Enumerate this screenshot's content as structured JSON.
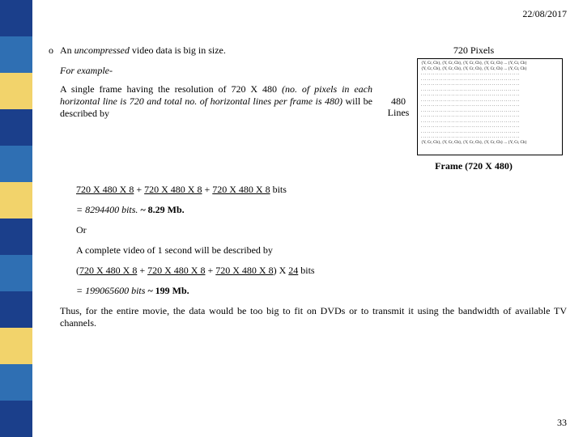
{
  "date": "22/08/2017",
  "bullet": {
    "marker": "o",
    "text_pre": "An ",
    "text_em": "uncompressed",
    "text_post": " video data is big in size."
  },
  "example_label": "For example-",
  "frame_desc_pre": "A single frame having the resolution of 720 X 480 ",
  "frame_desc_em": "(no. of pixels in each horizontal line is 720 and total no. of horizontal lines per frame is 480)",
  "frame_desc_post": " will be described by",
  "figure": {
    "top_label": "720 Pixels",
    "left_label_a": "480",
    "left_label_b": "Lines",
    "pixel_row": "{Y, Cr, Cb}, {Y, Cr, Cb}, {Y, Cr, Cb}, {Y, Cr, Cb} ... {Y, Cr, Cb}",
    "dot_row": ". . . . . . . . . . . . . . . . . . . . . . . . . . . . . . . . . . . . . . . . . . . . . . . . .",
    "caption": "Frame (720 X 480)"
  },
  "calc": {
    "line1_a": "720 X 480 X 8",
    "line1_b": "720 X 480 X 8",
    "line1_c": "720 X 480 X 8",
    "line1_suffix": "  bits",
    "line2_a": "= 8294400  bits.",
    "line2_b": "~ 8.29 Mb.",
    "or": "Or",
    "line3": "A complete video of 1 second will be described by",
    "line4_open": "(",
    "line4_a": "720 X 480 X 8",
    "line4_b": "720 X 480 X 8",
    "line4_c": "720 X 480 X 8",
    "line4_mid": ") X ",
    "line4_d": "24",
    "line4_suffix": " bits",
    "line5_a": "= 199065600 bits",
    "line5_b": "~ 199 Mb."
  },
  "conclusion": "Thus, for the entire movie, the data would be too big to fit on DVDs or to transmit it using the bandwidth of available TV channels.",
  "page_number": "33",
  "sidebar_colors": [
    "#1b3f8b",
    "#2f6fb3",
    "#f2d36b",
    "#1b3f8b",
    "#2f6fb3",
    "#f2d36b",
    "#1b3f8b",
    "#2f6fb3",
    "#1b3f8b",
    "#f2d36b",
    "#2f6fb3",
    "#1b3f8b"
  ]
}
